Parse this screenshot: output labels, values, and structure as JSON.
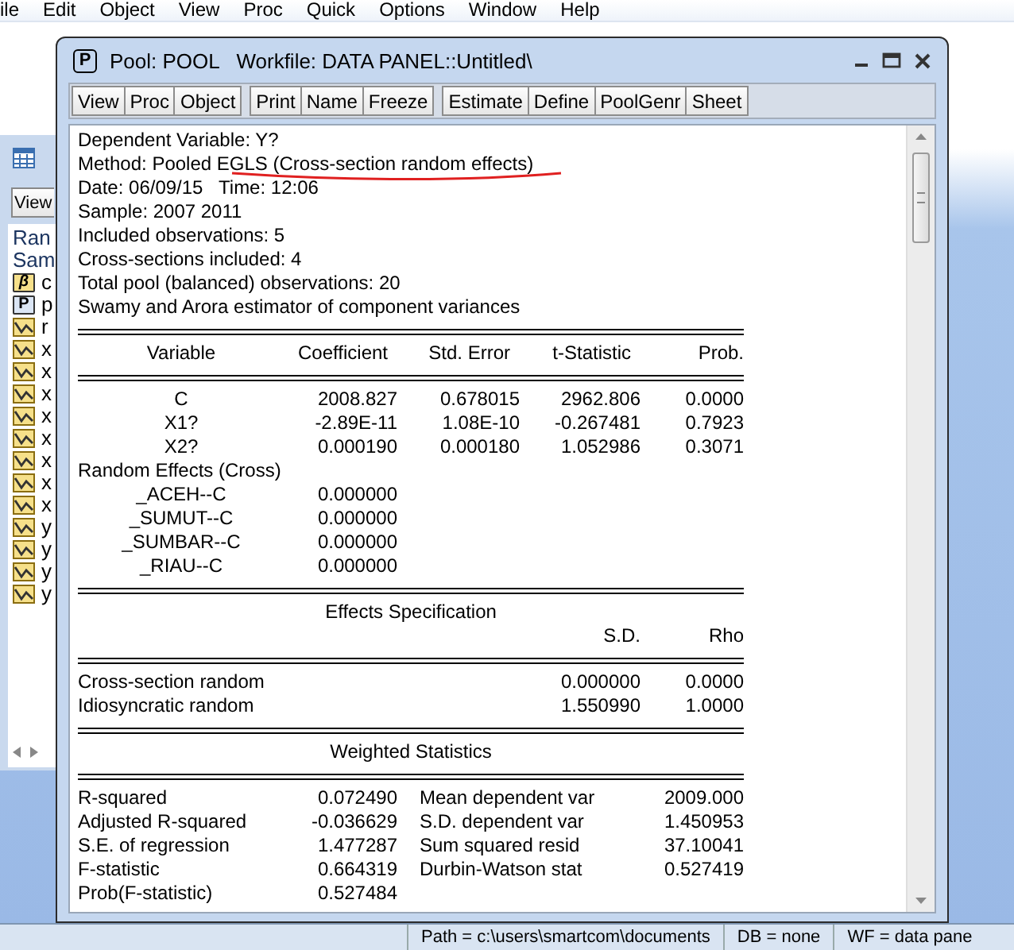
{
  "menu_bar": [
    "ile",
    "Edit",
    "Object",
    "View",
    "Proc",
    "Quick",
    "Options",
    "Window",
    "Help"
  ],
  "workfile_window": {
    "button": "View",
    "info_lines": [
      "Ran",
      "Sam"
    ],
    "items": [
      {
        "kind": "coef",
        "glyph": "β",
        "label": "c"
      },
      {
        "kind": "pool",
        "glyph": "P",
        "label": "p"
      },
      {
        "kind": "series",
        "label": "r"
      },
      {
        "kind": "series",
        "label": "x"
      },
      {
        "kind": "series",
        "label": "x"
      },
      {
        "kind": "series",
        "label": "x"
      },
      {
        "kind": "series",
        "label": "x"
      },
      {
        "kind": "series",
        "label": "x"
      },
      {
        "kind": "series",
        "label": "x"
      },
      {
        "kind": "series",
        "label": "x"
      },
      {
        "kind": "series",
        "label": "x"
      },
      {
        "kind": "series",
        "label": "y"
      },
      {
        "kind": "series",
        "label": "y"
      },
      {
        "kind": "series",
        "label": "y"
      },
      {
        "kind": "series",
        "label": "y"
      }
    ]
  },
  "pool_window": {
    "badge": "P",
    "title": "Pool: POOL   Workfile: DATA PANEL::Untitled\\",
    "toolbar": [
      [
        "View",
        "Proc",
        "Object"
      ],
      [
        "Print",
        "Name",
        "Freeze"
      ],
      [
        "Estimate",
        "Define",
        "PoolGenr",
        "Sheet"
      ]
    ]
  },
  "output": {
    "header_lines": [
      {
        "text": "Dependent Variable: Y?",
        "underlined": false
      },
      {
        "text": "Method: Pooled EGLS (Cross-section random effects)",
        "underlined": true
      },
      {
        "text": "Date: 06/09/15   Time: 12:06",
        "underlined": false
      },
      {
        "text": "Sample: 2007 2011",
        "underlined": false
      },
      {
        "text": "Included observations: 5",
        "underlined": false
      },
      {
        "text": "Cross-sections included: 4",
        "underlined": false
      },
      {
        "text": "Total pool (balanced) observations: 20",
        "underlined": false
      },
      {
        "text": "Swamy and Arora estimator of component variances",
        "underlined": false
      }
    ],
    "coef_table": {
      "columns": [
        "Variable",
        "Coefficient",
        "Std. Error",
        "t-Statistic",
        "Prob."
      ],
      "rows": [
        [
          "C",
          "2008.827",
          "0.678015",
          "2962.806",
          "0.0000"
        ],
        [
          "X1?",
          "-2.89E-11",
          "1.08E-10",
          "-0.267481",
          "0.7923"
        ],
        [
          "X2?",
          "0.000190",
          "0.000180",
          "1.052986",
          "0.3071"
        ]
      ],
      "group_label": "Random Effects (Cross)",
      "group_rows": [
        [
          "_ACEH--C",
          "0.000000"
        ],
        [
          "_SUMUT--C",
          "0.000000"
        ],
        [
          "_SUMBAR--C",
          "0.000000"
        ],
        [
          "_RIAU--C",
          "0.000000"
        ]
      ]
    },
    "effects_spec": {
      "title": "Effects Specification",
      "columns": [
        "",
        "S.D.",
        "Rho"
      ],
      "rows": [
        [
          "Cross-section random",
          "0.000000",
          "0.0000"
        ],
        [
          "Idiosyncratic random",
          "1.550990",
          "1.0000"
        ]
      ]
    },
    "weighted_stats": {
      "title": "Weighted Statistics",
      "rows": [
        [
          "R-squared",
          "0.072490",
          "Mean dependent var",
          "2009.000"
        ],
        [
          "Adjusted R-squared",
          "-0.036629",
          "S.D. dependent var",
          "1.450953"
        ],
        [
          "S.E. of regression",
          "1.477287",
          "Sum squared resid",
          "37.10041"
        ],
        [
          "F-statistic",
          "0.664319",
          "Durbin-Watson stat",
          "0.527419"
        ],
        [
          "Prob(F-statistic)",
          "0.527484"
        ]
      ]
    }
  },
  "status_bar": [
    "Path = c:\\users\\smartcom\\documents",
    "DB = none",
    "WF = data pane"
  ]
}
